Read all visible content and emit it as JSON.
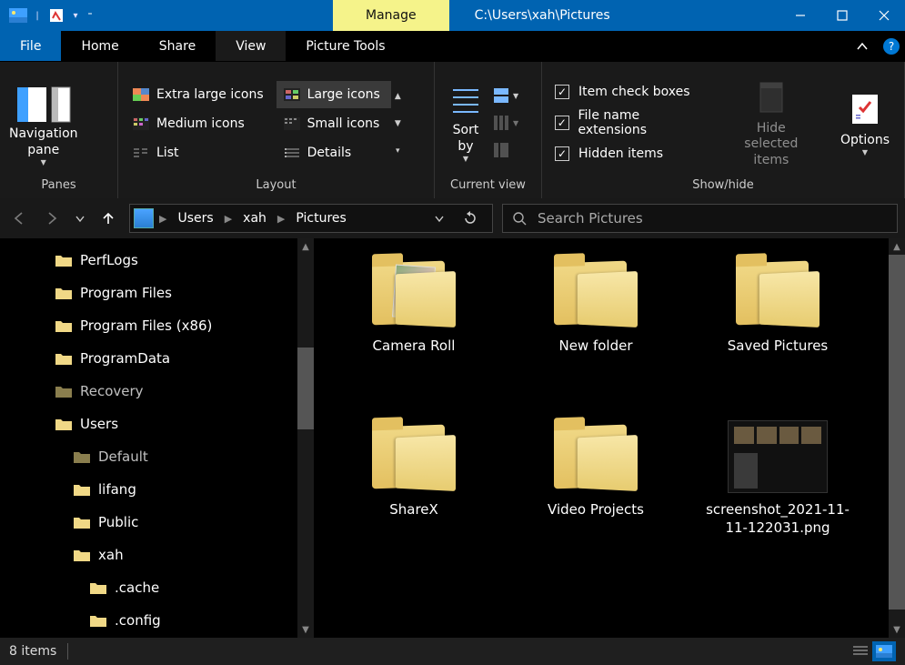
{
  "titlebar": {
    "context_tab": "Manage",
    "path": "C:\\Users\\xah\\Pictures"
  },
  "tabs": {
    "file": "File",
    "home": "Home",
    "share": "Share",
    "view": "View",
    "picture_tools": "Picture Tools"
  },
  "ribbon": {
    "panes": {
      "caption": "Panes",
      "navigation_pane": "Navigation\npane"
    },
    "layout": {
      "caption": "Layout",
      "xl": "Extra large icons",
      "l": "Large icons",
      "m": "Medium icons",
      "s": "Small icons",
      "list": "List",
      "details": "Details"
    },
    "current_view": {
      "caption": "Current view",
      "sort_by": "Sort\nby"
    },
    "show_hide": {
      "caption": "Show/hide",
      "item_checkboxes": "Item check boxes",
      "file_ext": "File name extensions",
      "hidden_items": "Hidden items",
      "hide_selected": "Hide selected\nitems",
      "options": "Options"
    }
  },
  "breadcrumb": [
    "Users",
    "xah",
    "Pictures"
  ],
  "search": {
    "placeholder": "Search Pictures"
  },
  "tree": [
    {
      "indent": 60,
      "label": "PerfLogs"
    },
    {
      "indent": 60,
      "label": "Program Files"
    },
    {
      "indent": 60,
      "label": "Program Files (x86)"
    },
    {
      "indent": 60,
      "label": "ProgramData"
    },
    {
      "indent": 60,
      "label": "Recovery",
      "dim": true
    },
    {
      "indent": 60,
      "label": "Users"
    },
    {
      "indent": 80,
      "label": "Default",
      "dim": true
    },
    {
      "indent": 80,
      "label": "lifang"
    },
    {
      "indent": 80,
      "label": "Public"
    },
    {
      "indent": 80,
      "label": "xah"
    },
    {
      "indent": 98,
      "label": ".cache"
    },
    {
      "indent": 98,
      "label": ".config"
    }
  ],
  "items": [
    {
      "type": "folder",
      "label": "Camera Roll",
      "preview": true
    },
    {
      "type": "folder",
      "label": "New folder"
    },
    {
      "type": "folder",
      "label": "Saved Pictures"
    },
    {
      "type": "folder",
      "label": "ShareX"
    },
    {
      "type": "folder",
      "label": "Video Projects"
    },
    {
      "type": "png",
      "label": "screenshot_2021-11-11-122031.png"
    }
  ],
  "status": {
    "count": "8 items"
  }
}
